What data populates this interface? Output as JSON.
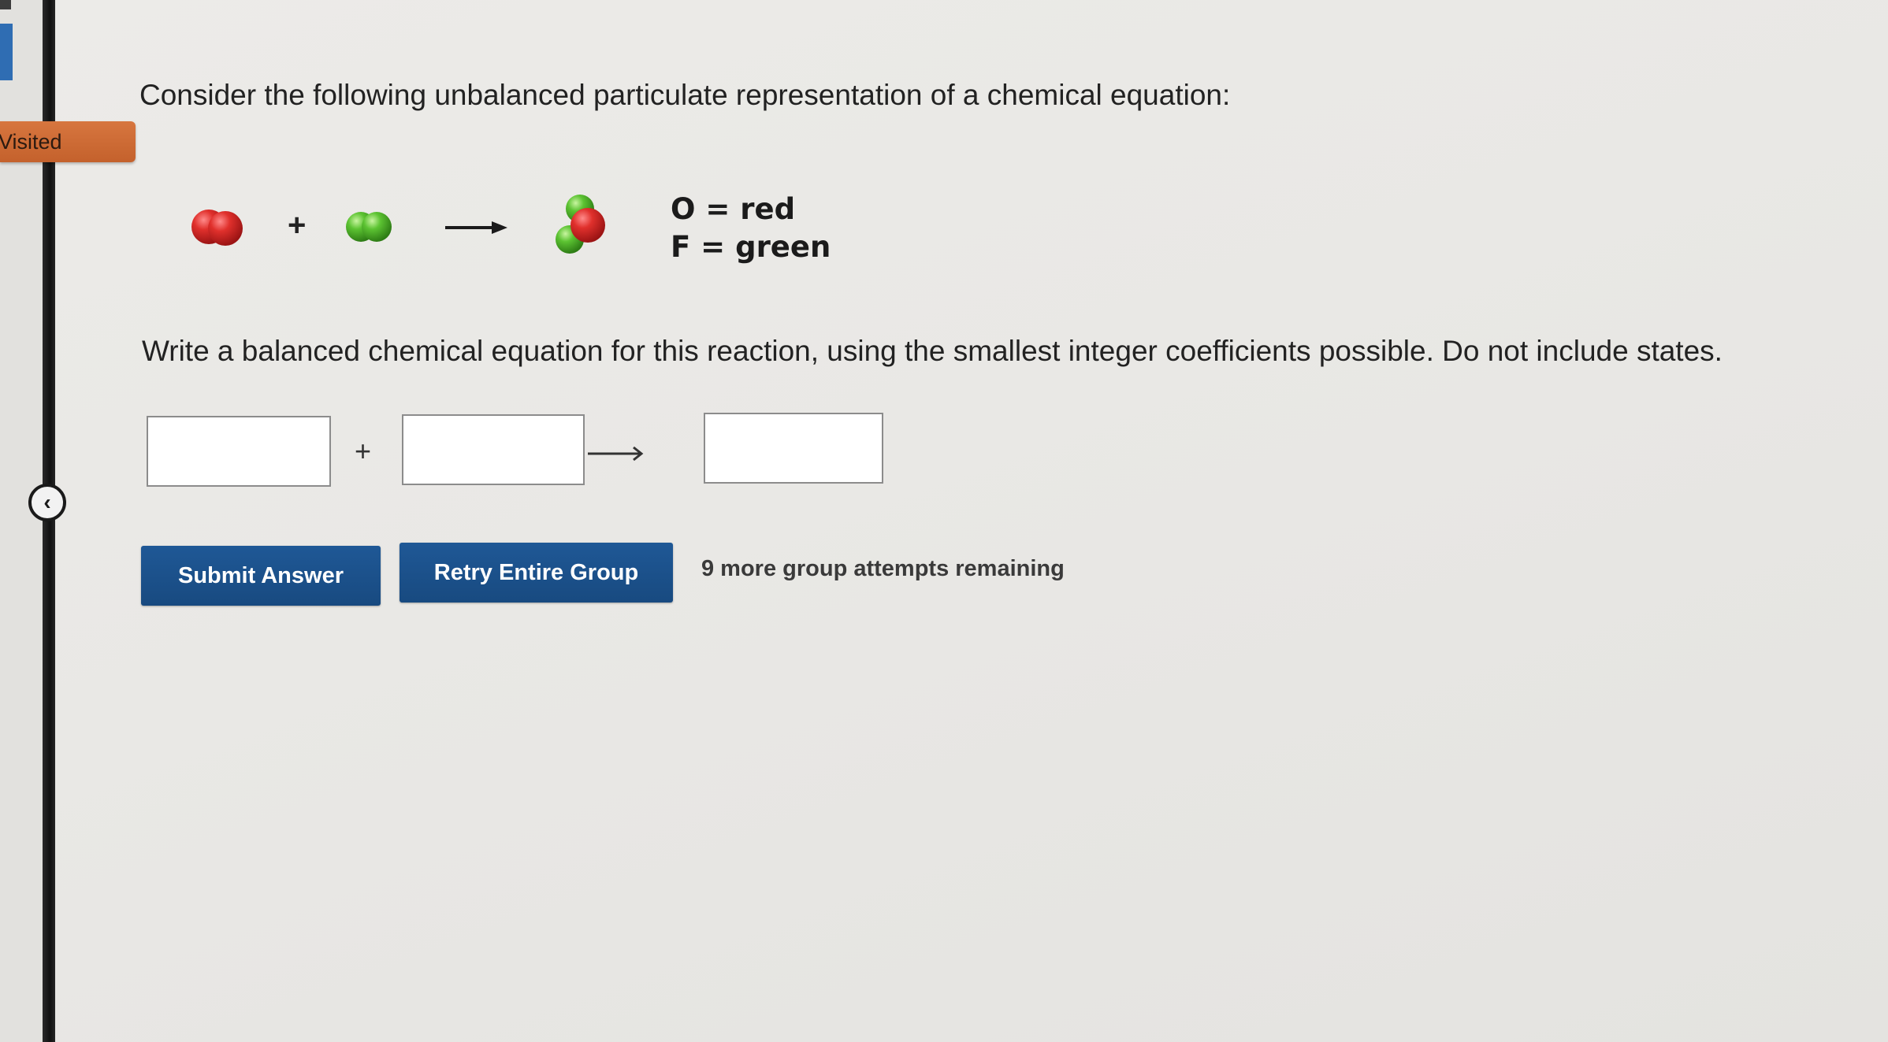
{
  "sidebar": {
    "visited_label": "Visited",
    "collapse_icon": "chevron-left-icon"
  },
  "question": {
    "prompt": "Consider the following unbalanced particulate representation of a chemical equation:",
    "legend": [
      {
        "symbol": "O",
        "equals": "=",
        "color_name": "red"
      },
      {
        "symbol": "F",
        "equals": "=",
        "color_name": "green"
      }
    ],
    "plus": "+",
    "instructions": "Write a balanced chemical equation for this reaction, using the smallest integer coefficients possible. Do not include states."
  },
  "equation": {
    "reactant1_value": "",
    "plus": "+",
    "reactant2_value": "",
    "product_value": ""
  },
  "actions": {
    "submit_label": "Submit Answer",
    "retry_label": "Retry Entire Group",
    "attempts_text": "9 more group attempts remaining"
  },
  "colors": {
    "oxygen": "#d42a2a",
    "fluorine": "#4bb52a",
    "button": "#1c5290",
    "visited_tab": "#d06b35"
  }
}
